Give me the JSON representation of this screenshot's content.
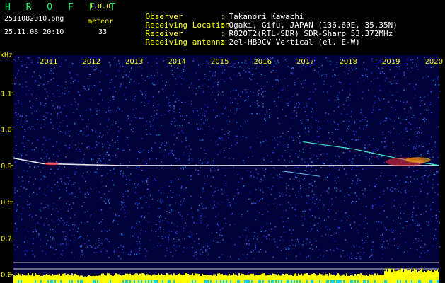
{
  "header": {
    "app_title": "H R O F F T",
    "app_version": "1.0.0",
    "filename": "2511082010.png",
    "meteor_label": "meteor",
    "datetime": "25.11.08 20:10",
    "meteor_count": "33",
    "info": [
      {
        "label": "Observer",
        "value": "Takanori Kawachi"
      },
      {
        "label": "Receiving Location",
        "value": "Ogaki, Gifu, JAPAN (136.60E, 35.35N)"
      },
      {
        "label": "Receiver",
        "value": "R820T2(RTL-SDR) SDR-Sharp 53.372MHz"
      },
      {
        "label": "Receiving antenna",
        "value": "2el-HB9CV Vertical (el. E-W)"
      }
    ],
    "colon": ":"
  },
  "axis": {
    "unit": "kHz"
  },
  "chart_data": {
    "type": "heatmap",
    "title": "",
    "xlabel": "",
    "ylabel": "kHz",
    "x_ticks": [
      "2011",
      "2012",
      "2013",
      "2014",
      "2015",
      "2016",
      "2017",
      "2018",
      "2019",
      "2020"
    ],
    "y_ticks": [
      "1.1",
      "1.0",
      "0.9",
      "0.8",
      "0.7",
      "0.6"
    ],
    "ylim": [
      0.58,
      1.2
    ],
    "colors": {
      "background": "#00003a",
      "noise": "#1f3cff",
      "carrier": "#ffffff",
      "hot": "#ff3030",
      "level_bar": "#ffff00",
      "level_base": "#00d0ff"
    },
    "traces": [
      {
        "name": "carrier",
        "points": [
          [
            0,
            0.92
          ],
          [
            0.07,
            0.905
          ],
          [
            0.25,
            0.9
          ],
          [
            0.5,
            0.9
          ],
          [
            0.75,
            0.9
          ],
          [
            1,
            0.9
          ]
        ]
      },
      {
        "name": "drift-upper",
        "points": [
          [
            0.68,
            0.965
          ],
          [
            0.8,
            0.945
          ],
          [
            0.9,
            0.92
          ],
          [
            1,
            0.9
          ]
        ]
      },
      {
        "name": "drift-lower",
        "points": [
          [
            0.63,
            0.885
          ],
          [
            0.72,
            0.87
          ]
        ]
      }
    ]
  }
}
